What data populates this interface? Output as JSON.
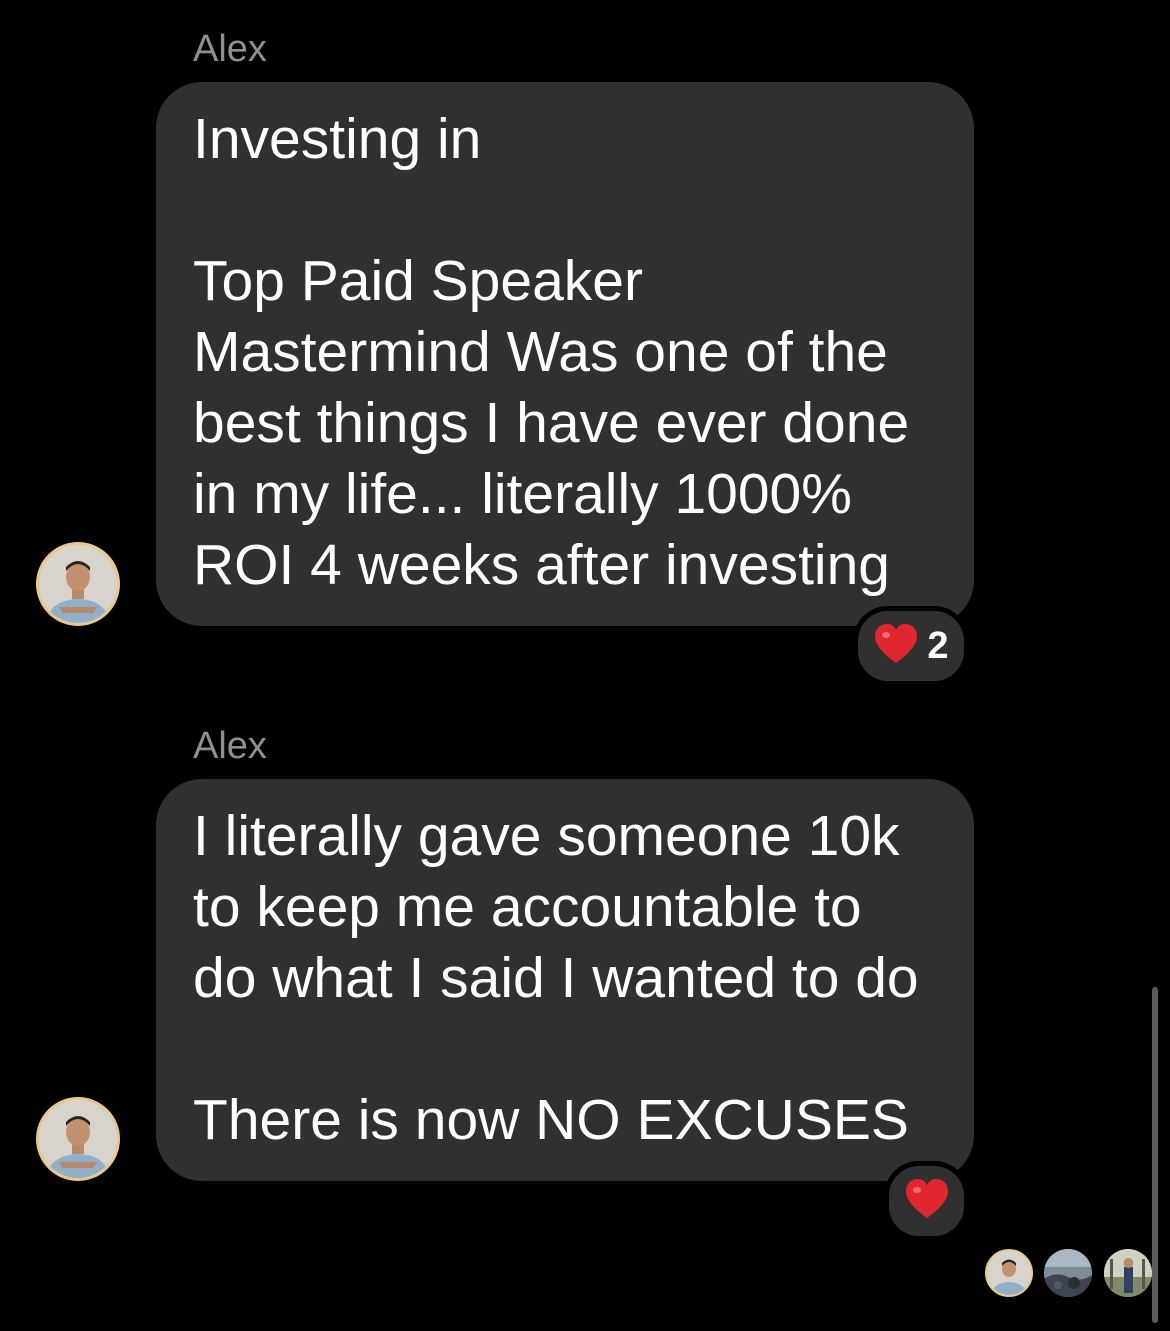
{
  "messages": [
    {
      "sender": "Alex",
      "lines": [
        "Investing in",
        "",
        "Top Paid Speaker",
        "Mastermind Was one of the",
        "best things I have ever done",
        "in my life... literally 1000%",
        "ROI 4 weeks after investing"
      ],
      "reaction": {
        "emoji": "❤️",
        "count": "2"
      }
    },
    {
      "sender": "Alex",
      "lines": [
        "I literally gave someone 10k",
        "to keep me accountable to",
        "do what I said I wanted to do",
        "",
        "There is now NO EXCUSES"
      ],
      "reaction": {
        "emoji": "❤️",
        "count": ""
      }
    }
  ],
  "read_receipts": [
    "avatar",
    "avatar",
    "avatar"
  ],
  "colors": {
    "background": "#000000",
    "bubble": "#303030",
    "sender_text": "#8e8e93",
    "heart": "#e0262f",
    "avatar_ring": "#e8c98a"
  }
}
